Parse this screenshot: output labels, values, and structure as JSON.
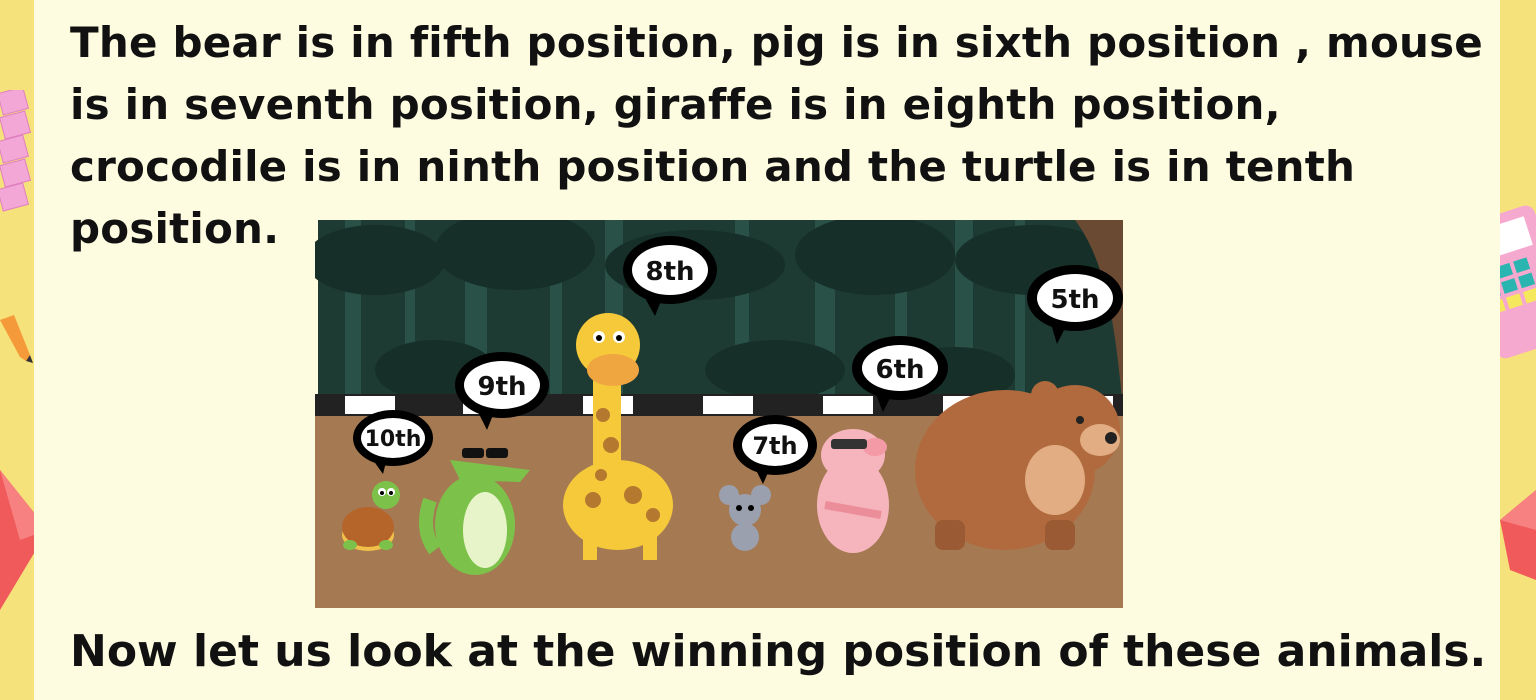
{
  "text": {
    "paragraph": "The bear is in fifth position, pig is in sixth position , mouse is in seventh position, giraffe is in eighth position, crocodile is in ninth position and the turtle is in tenth position.",
    "footer": "Now let us look at the winning position of these animals."
  },
  "positions": {
    "bear": "5th",
    "pig": "6th",
    "mouse": "7th",
    "giraffe": "8th",
    "crocodile": "9th",
    "turtle": "10th"
  },
  "colors": {
    "background": "#f6e27a",
    "card": "#fdfbe0",
    "forest": "#1f3f38",
    "ground": "#a57a52",
    "bubble": "#000000"
  }
}
